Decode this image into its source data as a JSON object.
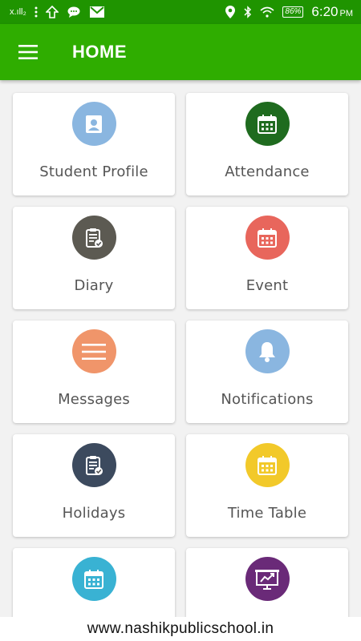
{
  "status_bar": {
    "signal_text": "x.ıll₂",
    "battery": "86%",
    "time": "6:20",
    "ampm": "PM"
  },
  "header": {
    "title": "HOME",
    "menu_icon": "hamburger-menu-icon"
  },
  "tiles": [
    {
      "label": "Student Profile",
      "icon": "contact-card-icon",
      "color": "#8ab6e0"
    },
    {
      "label": "Attendance",
      "icon": "calendar-icon",
      "color": "#1f6b1f"
    },
    {
      "label": "Diary",
      "icon": "clipboard-check-icon",
      "color": "#5c5a52"
    },
    {
      "label": "Event",
      "icon": "calendar-icon",
      "color": "#e8665c"
    },
    {
      "label": "Messages",
      "icon": "lines-icon",
      "color": "#f0956a"
    },
    {
      "label": "Notifications",
      "icon": "bell-icon",
      "color": "#8ab6e0"
    },
    {
      "label": "Holidays",
      "icon": "clipboard-check-icon",
      "color": "#3c4a5e"
    },
    {
      "label": "Time Table",
      "icon": "calendar-icon",
      "color": "#f2c92a"
    },
    {
      "label": "",
      "icon": "calendar-icon",
      "color": "#39b2d3"
    },
    {
      "label": "",
      "icon": "presentation-chart-icon",
      "color": "#6a2a78"
    }
  ],
  "footer": {
    "url": "www.nashikpublicschool.in"
  }
}
